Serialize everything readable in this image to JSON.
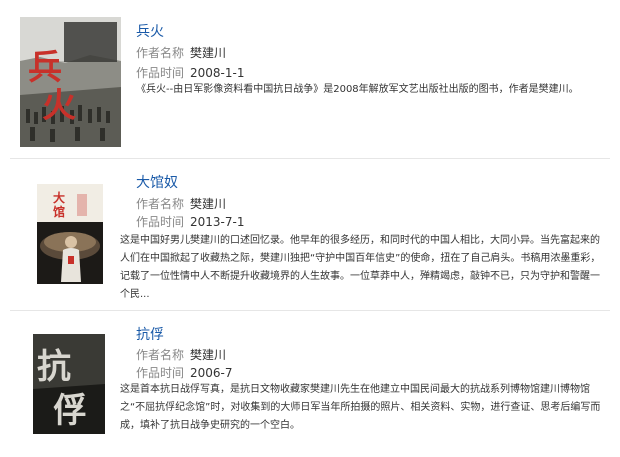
{
  "items": [
    {
      "title": "兵火",
      "author_label": "作者名称",
      "author": "樊建川",
      "date_label": "作品时间",
      "date": "2008-1-1",
      "description": "《兵火--由日军影像资料看中国抗日战争》是2008年解放军文艺出版社出版的图书，作者是樊建川。",
      "cover": {
        "icon": "book-cover-binghuo",
        "title_glyphs": "兵火",
        "subtitle": "由日军影像资料看中国抗日战争"
      }
    },
    {
      "title": "大馆奴",
      "author_label": "作者名称",
      "author": "樊建川",
      "date_label": "作品时间",
      "date": "2013-7-1",
      "description": "这是中国好男儿樊建川的口述回忆录。他早年的很多经历，和同时代的中国人相比，大同小异。当先富起来的人们在中国掀起了收藏热之际，樊建川独把“守护中国百年信史”的使命，扭在了自己肩头。书稿用浓墨重彩，记载了一位性情中人不断提升收藏境界的人生故事。一位草莽中人，殚精竭虑，敲钟不已，只为守护和警醒一个民...",
      "cover": {
        "icon": "book-cover-daguannu",
        "title_glyphs": "大馆奴"
      }
    },
    {
      "title": "抗俘",
      "author_label": "作者名称",
      "author": "樊建川",
      "date_label": "作品时间",
      "date": "2006-7",
      "description": "这是首本抗日战俘写真，是抗日文物收藏家樊建川先生在他建立中国民间最大的抗战系列博物馆建川博物馆之“不屈抗俘纪念馆”时，对收集到的大师日军当年所拍摄的照片、相关资料、实物，进行查证、思考后编写而成，填补了抗日战争史研究的一个空白。",
      "cover": {
        "icon": "book-cover-kangfu",
        "title_glyphs": "抗俘"
      }
    }
  ],
  "colors": {
    "title_link": "#1a5aa8",
    "label": "#888888",
    "separator": "#e6e6e6",
    "cover_red": "#c8312a"
  }
}
